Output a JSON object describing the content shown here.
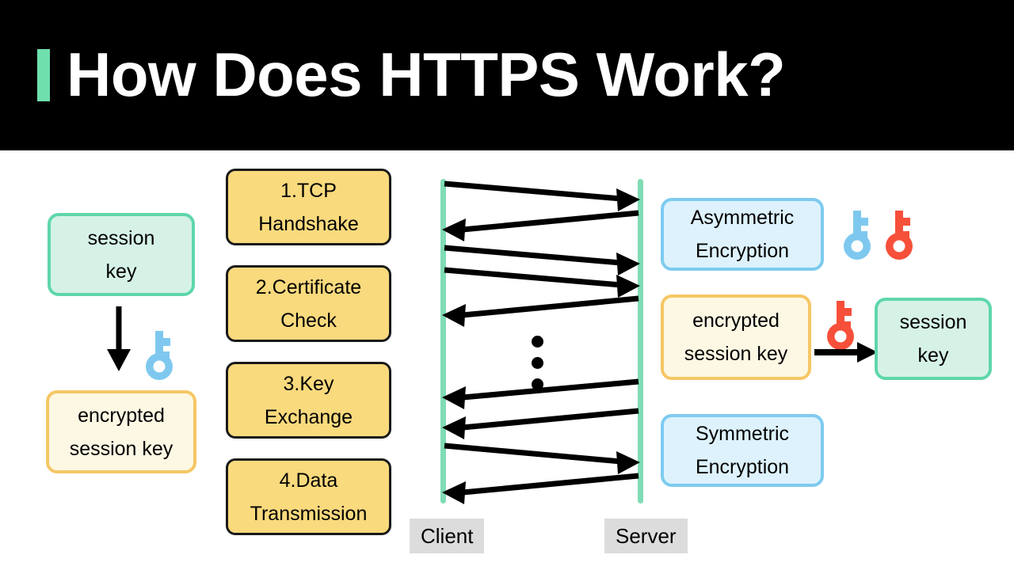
{
  "header": {
    "title": "How Does HTTPS Work?",
    "accent_color": "#6fdfae",
    "background_color": "#000000",
    "text_color": "#ffffff"
  },
  "colors": {
    "green_fill": "#d6f2e7",
    "green_border": "#5ed7ab",
    "cream_fill": "#fdf8e3",
    "cream_border": "#f5c765",
    "yellow_fill": "#f9da7d",
    "yellow_border": "#1a1a1a",
    "blue_fill": "#ddf2fc",
    "blue_border": "#7ecbf0",
    "lifeline_green": "#7fdcb4",
    "actor_label_bg": "#dcdcdc",
    "key_blue": "#7ec8ef",
    "key_red": "#f7503a",
    "arrow_black": "#000000"
  },
  "left_panel": {
    "session_key_box": {
      "line1": "session",
      "line2": "key"
    },
    "encrypted_box": {
      "line1": "encrypted",
      "line2": "session key"
    },
    "key_icon": "key-icon-blue",
    "arrow": "down-arrow"
  },
  "steps": [
    {
      "line1": "1.TCP",
      "line2": "Handshake"
    },
    {
      "line1": "2.Certificate",
      "line2": "Check"
    },
    {
      "line1": "3.Key",
      "line2": "Exchange"
    },
    {
      "line1": "4.Data",
      "line2": "Transmission"
    }
  ],
  "sequence": {
    "client_label": "Client",
    "server_label": "Server",
    "ellipsis_dots": 3,
    "messages": [
      {
        "direction": "client-to-server"
      },
      {
        "direction": "server-to-client"
      },
      {
        "direction": "client-to-server"
      },
      {
        "direction": "client-to-server"
      },
      {
        "direction": "server-to-client"
      },
      {
        "direction": "server-to-client"
      },
      {
        "direction": "server-to-client"
      },
      {
        "direction": "client-to-server"
      },
      {
        "direction": "server-to-client"
      }
    ]
  },
  "right_panel": {
    "asymmetric_box": {
      "line1": "Asymmetric",
      "line2": "Encryption"
    },
    "asymmetric_keys": [
      "key-icon-blue",
      "key-icon-red"
    ],
    "encrypted_box": {
      "line1": "encrypted",
      "line2": "session key"
    },
    "decrypt_key_icon": "key-icon-red",
    "decrypt_arrow": "right-arrow",
    "session_key_box": {
      "line1": "session",
      "line2": "key"
    },
    "symmetric_box": {
      "line1": "Symmetric",
      "line2": "Encryption"
    }
  }
}
